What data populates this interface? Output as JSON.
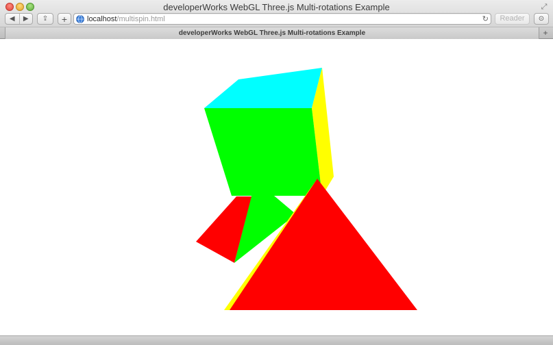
{
  "window": {
    "title": "developerWorks WebGL Three.js Multi-rotations Example"
  },
  "toolbar": {
    "back_icon": "◀",
    "forward_icon": "▶",
    "share_icon": "⇪",
    "add_icon": "+",
    "reader_label": "Reader",
    "downloads_icon": "⊙",
    "fullscreen_icon": "⤢",
    "reload_icon": "↻"
  },
  "address": {
    "host": "localhost",
    "path": "/multispin.html"
  },
  "tabs": [
    {
      "label": "developerWorks WebGL Three.js Multi-rotations Example"
    }
  ],
  "tab_bar": {
    "new_tab_icon": "+"
  },
  "scene": {
    "colors": {
      "cube_top": "#00ffff",
      "cube_front": "#00ff00",
      "cube_side": "#ffff00",
      "pyramid_left": "#ff0000",
      "pyramid_front": "#ff0000",
      "pyramid_edge": "#ffff00",
      "background": "#ffffff"
    }
  }
}
